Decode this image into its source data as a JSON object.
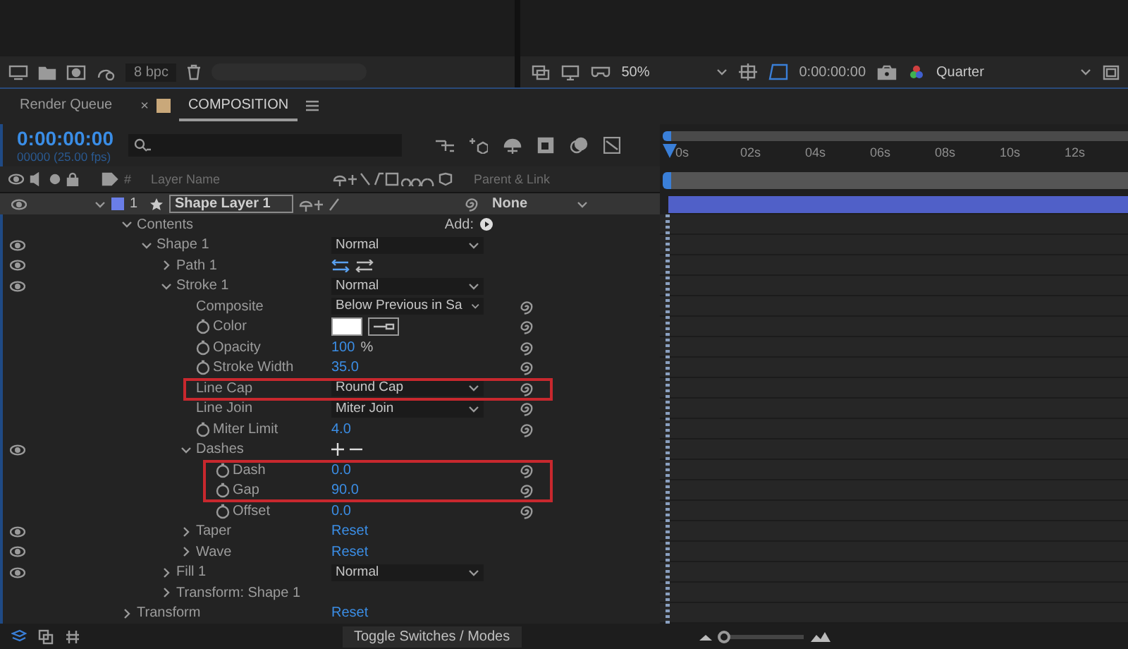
{
  "toolbar_left": {
    "bpc": "8 bpc"
  },
  "toolbar_right": {
    "zoom": "50%",
    "timecode": "0:00:00:00",
    "resolution": "Quarter"
  },
  "tabs": [
    {
      "label": "Render Queue",
      "selected": false
    },
    {
      "label": "COMPOSITION",
      "selected": true,
      "close": "×"
    }
  ],
  "timecode": "0:00:00:00",
  "frame_info": "00000 (25.00 fps)",
  "columns": {
    "number": "#",
    "layer_name": "Layer Name",
    "parent": "Parent & Link"
  },
  "layer": {
    "number": "1",
    "name": "Shape Layer 1",
    "parent": "None",
    "visible": true,
    "expanded": true,
    "children": [
      {
        "label": "Contents",
        "kind": "group",
        "expanded": true,
        "visible": false,
        "highlight": false,
        "link": false,
        "value": {
          "kind": "add",
          "text": "Add:"
        },
        "children": [
          {
            "label": "Shape 1",
            "kind": "group",
            "expanded": true,
            "visible": true,
            "highlight": false,
            "link": false,
            "value": {
              "kind": "dropdown",
              "text": "Normal"
            },
            "children": [
              {
                "label": "Path 1",
                "kind": "group",
                "expanded": false,
                "visible": true,
                "highlight": false,
                "link": false,
                "value": {
                  "kind": "path-icons"
                }
              },
              {
                "label": "Stroke 1",
                "kind": "group",
                "expanded": true,
                "visible": true,
                "highlight": false,
                "link": false,
                "value": {
                  "kind": "dropdown",
                  "text": "Normal"
                },
                "children": [
                  {
                    "label": "Composite",
                    "kind": "property",
                    "stopwatch": false,
                    "visible": false,
                    "highlight": false,
                    "link": true,
                    "value": {
                      "kind": "dropdown",
                      "text": "Below Previous in Sa"
                    }
                  },
                  {
                    "label": "Color",
                    "kind": "property",
                    "stopwatch": true,
                    "visible": false,
                    "highlight": false,
                    "link": true,
                    "value": {
                      "kind": "color",
                      "color": "#ffffff"
                    }
                  },
                  {
                    "label": "Opacity",
                    "kind": "property",
                    "stopwatch": true,
                    "visible": false,
                    "highlight": false,
                    "link": true,
                    "value": {
                      "kind": "number",
                      "text": "100",
                      "unit": "%"
                    }
                  },
                  {
                    "label": "Stroke Width",
                    "kind": "property",
                    "stopwatch": true,
                    "visible": false,
                    "highlight": false,
                    "link": true,
                    "value": {
                      "kind": "number",
                      "text": "35.0"
                    }
                  },
                  {
                    "label": "Line Cap",
                    "kind": "property",
                    "stopwatch": false,
                    "visible": false,
                    "highlight": true,
                    "link": true,
                    "value": {
                      "kind": "dropdown",
                      "text": "Round Cap"
                    }
                  },
                  {
                    "label": "Line Join",
                    "kind": "property",
                    "stopwatch": false,
                    "visible": false,
                    "highlight": false,
                    "link": true,
                    "value": {
                      "kind": "dropdown",
                      "text": "Miter Join"
                    }
                  },
                  {
                    "label": "Miter Limit",
                    "kind": "property",
                    "stopwatch": true,
                    "visible": false,
                    "highlight": false,
                    "link": true,
                    "value": {
                      "kind": "number",
                      "text": "4.0"
                    }
                  },
                  {
                    "label": "Dashes",
                    "kind": "group",
                    "expanded": true,
                    "visible": true,
                    "highlight": false,
                    "link": false,
                    "value": {
                      "kind": "plus-minus"
                    },
                    "children": [
                      {
                        "label": "Dash",
                        "kind": "property",
                        "stopwatch": true,
                        "visible": false,
                        "highlight": true,
                        "link": true,
                        "value": {
                          "kind": "number",
                          "text": "0.0"
                        }
                      },
                      {
                        "label": "Gap",
                        "kind": "property",
                        "stopwatch": true,
                        "visible": false,
                        "highlight": true,
                        "link": true,
                        "value": {
                          "kind": "number",
                          "text": "90.0"
                        }
                      },
                      {
                        "label": "Offset",
                        "kind": "property",
                        "stopwatch": true,
                        "visible": false,
                        "highlight": false,
                        "link": true,
                        "value": {
                          "kind": "number",
                          "text": "0.0"
                        }
                      }
                    ]
                  },
                  {
                    "label": "Taper",
                    "kind": "group",
                    "expanded": false,
                    "visible": true,
                    "highlight": false,
                    "link": false,
                    "value": {
                      "kind": "reset",
                      "text": "Reset"
                    }
                  },
                  {
                    "label": "Wave",
                    "kind": "group",
                    "expanded": false,
                    "visible": true,
                    "highlight": false,
                    "link": false,
                    "value": {
                      "kind": "reset",
                      "text": "Reset"
                    }
                  }
                ]
              },
              {
                "label": "Fill 1",
                "kind": "group",
                "expanded": false,
                "visible": true,
                "highlight": false,
                "link": false,
                "value": {
                  "kind": "dropdown",
                  "text": "Normal"
                }
              },
              {
                "label": "Transform: Shape 1",
                "kind": "group",
                "expanded": false,
                "visible": false,
                "highlight": false,
                "link": false
              }
            ]
          }
        ]
      },
      {
        "label": "Transform",
        "kind": "group",
        "expanded": false,
        "visible": false,
        "highlight": false,
        "link": false,
        "value": {
          "kind": "reset",
          "text": "Reset"
        }
      }
    ]
  },
  "timeline": {
    "ticks": [
      "0s",
      "02s",
      "04s",
      "06s",
      "08s",
      "10s",
      "12s"
    ]
  },
  "zoom_slider": {
    "level": 0.05
  },
  "status_bar": {
    "toggle": "Toggle Switches / Modes"
  }
}
